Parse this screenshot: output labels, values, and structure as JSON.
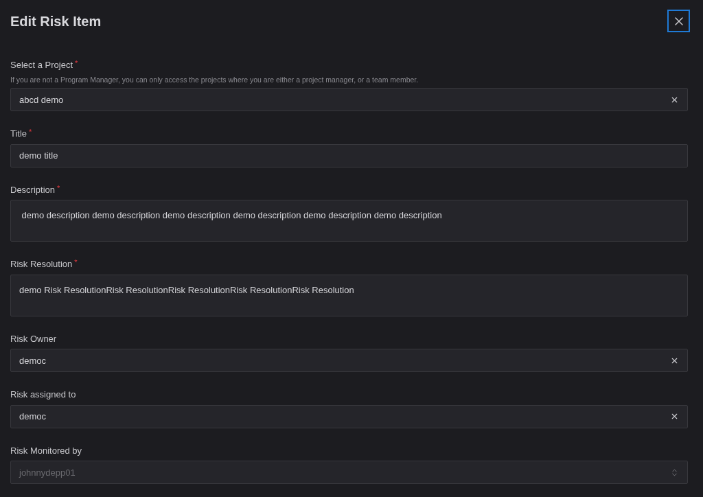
{
  "dialog": {
    "title": "Edit Risk Item",
    "close_button": {
      "focused": true
    }
  },
  "fields": [
    {
      "kind": "select",
      "label": "Select a Project",
      "required_mark": "*",
      "hint": "If you are not a Program Manager, you can only access the projects where you are either a project manager, or a team member.",
      "value": "abcd demo",
      "disabled": false
    },
    {
      "kind": "text",
      "label": "Title",
      "required_mark": "*",
      "value": "demo title",
      "disabled": false
    },
    {
      "kind": "textarea",
      "label": "Description",
      "required_mark": "*",
      "value": " demo description demo description demo description demo description demo description demo description",
      "disabled": false
    },
    {
      "kind": "textarea",
      "label": "Risk Resolution",
      "required_mark": "*",
      "value": "demo Risk ResolutionRisk ResolutionRisk ResolutionRisk ResolutionRisk Resolution",
      "disabled": false
    },
    {
      "kind": "select",
      "label": "Risk Owner",
      "value": "democ",
      "disabled": false
    },
    {
      "kind": "select",
      "label": "Risk assigned to",
      "value": "democ",
      "disabled": false
    },
    {
      "kind": "dropdown",
      "label": "Risk Monitored by",
      "value": "johnnydepp01",
      "disabled": true
    }
  ]
}
